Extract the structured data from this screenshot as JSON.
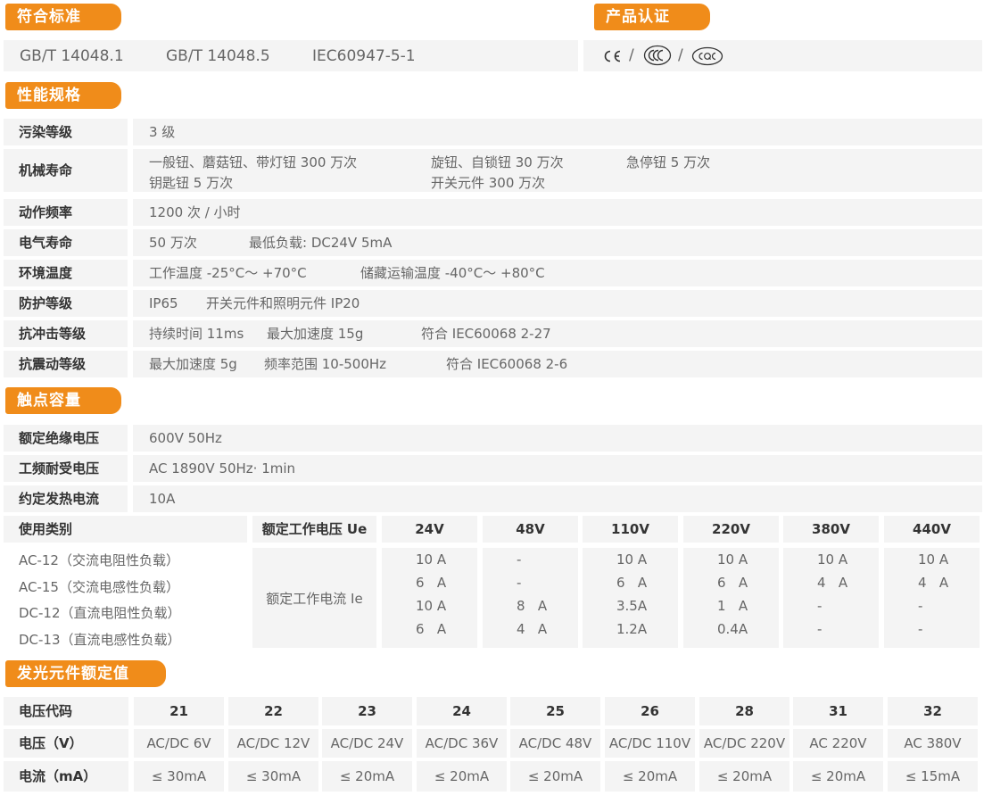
{
  "standards": {
    "title": "符合标准",
    "items": [
      "GB/T 14048.1",
      "GB/T 14048.5",
      "IEC60947-5-1"
    ]
  },
  "certification": {
    "title": "产品认证",
    "logos": [
      "CE",
      "CCC",
      "CQC"
    ],
    "separator": "/"
  },
  "performance": {
    "title": "性能规格",
    "rows": [
      {
        "label": "污染等级",
        "values": [
          "3 级"
        ]
      },
      {
        "label": "机械寿命",
        "values": [
          "一般钮、蘑菇钮、带灯钮 300 万次",
          "旋钮、自锁钮 30 万次",
          "急停钮 5 万次",
          "钥匙钮 5 万次",
          "开关元件 300 万次"
        ]
      },
      {
        "label": "动作频率",
        "values": [
          "1200 次 / 小时"
        ]
      },
      {
        "label": "电气寿命",
        "values": [
          "50 万次",
          "最低负载: DC24V  5mA"
        ]
      },
      {
        "label": "环境温度",
        "values": [
          "工作温度 -25°C～ +70°C",
          "储藏运输温度 -40°C～ +80°C"
        ]
      },
      {
        "label": "防护等级",
        "values": [
          "IP65",
          "开关元件和照明元件 IP20"
        ]
      },
      {
        "label": "抗冲击等级",
        "values": [
          "持续时间 11ms",
          "最大加速度 15g",
          "符合 IEC60068  2-27"
        ]
      },
      {
        "label": "抗震动等级",
        "values": [
          "最大加速度 5g",
          "频率范围  10-500Hz",
          "符合 IEC60068  2-6"
        ]
      }
    ]
  },
  "contact": {
    "title": "触点容量",
    "rows": [
      {
        "label": "额定绝缘电压",
        "value": "600V  50Hz"
      },
      {
        "label": "工频耐受电压",
        "value": "AC 1890V  50Hz· 1min"
      },
      {
        "label": "约定发热电流",
        "value": "10A"
      }
    ],
    "table": {
      "category_header": "使用类别",
      "voltage_header": "额定工作电压 Ue",
      "current_label": "额定工作电流 Ie",
      "voltages": [
        "24V",
        "48V",
        "110V",
        "220V",
        "380V",
        "440V"
      ],
      "categories": [
        "AC-12（交流电阻性负载）",
        "AC-15（交流电感性负载）",
        "DC-12（直流电阻性负载）",
        "DC-13（直流电感性负载）"
      ],
      "columns": [
        [
          "10 A",
          "6   A",
          "10 A",
          "6   A"
        ],
        [
          "-",
          "-",
          "8   A",
          "4   A"
        ],
        [
          "10 A",
          "6   A",
          "3.5A",
          "1.2A"
        ],
        [
          "10 A",
          "6   A",
          "1   A",
          "0.4A"
        ],
        [
          "10 A",
          "4   A",
          "-",
          "-"
        ],
        [
          "10 A",
          "4   A",
          "-",
          "-"
        ]
      ]
    }
  },
  "led": {
    "title": "发光元件额定值",
    "row_labels": [
      "电压代码",
      "电压（V）",
      "电流（mA）"
    ],
    "codes": [
      "21",
      "22",
      "23",
      "24",
      "25",
      "26",
      "28",
      "31",
      "32"
    ],
    "voltages": [
      "AC/DC 6V",
      "AC/DC 12V",
      "AC/DC 24V",
      "AC/DC 36V",
      "AC/DC 48V",
      "AC/DC 110V",
      "AC/DC 220V",
      "AC 220V",
      "AC 380V"
    ],
    "currents": [
      "≤ 30mA",
      "≤ 30mA",
      "≤ 20mA",
      "≤ 20mA",
      "≤ 20mA",
      "≤ 20mA",
      "≤ 20mA",
      "≤ 20mA",
      "≤ 15mA"
    ]
  },
  "colors": {
    "accent": "#f08c1a",
    "row_bg": "#f4f4f4"
  }
}
